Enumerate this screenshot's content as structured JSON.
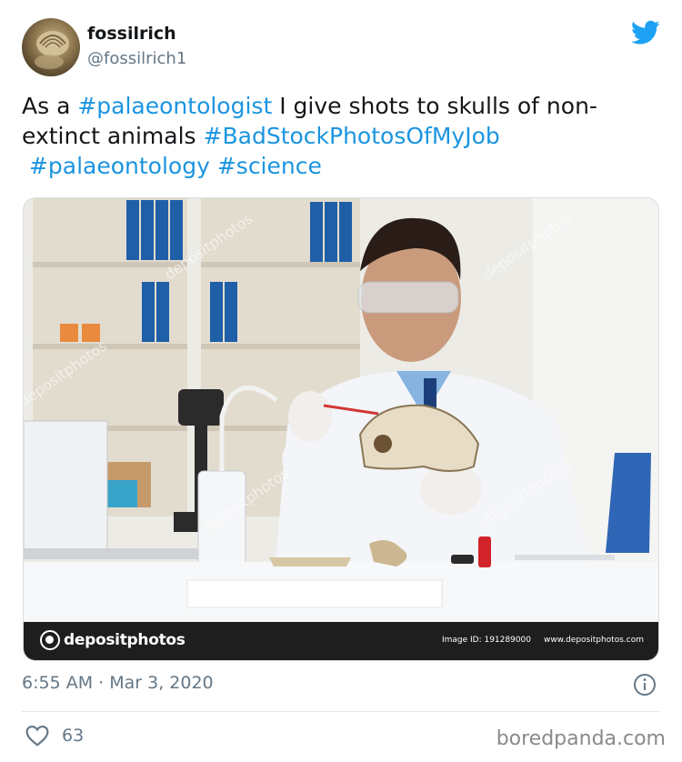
{
  "tweet": {
    "display_name": "fossilrich",
    "handle": "@fossilrich1",
    "text": {
      "part1": "As a ",
      "tag1": "#palaeontologist",
      "part2": " I give shots to skulls of non-extinct animals ",
      "tag2": "#BadStockPhotosOfMyJob",
      "tag3": "#palaeontology",
      "tag4": "#science"
    },
    "timestamp": "6:55 AM · Mar 3, 2020",
    "likes": "63"
  },
  "photo": {
    "brand": "depositphotos",
    "image_id": "Image ID: 191289000",
    "url": "www.depositphotos.com"
  },
  "source_watermark": "boredpanda.com",
  "icons": {
    "avatar": "fossil-avatar",
    "brand_logo": "twitter-bird-icon",
    "info": "info-icon",
    "like": "heart-icon"
  },
  "colors": {
    "hashtag": "#1b95e0",
    "twitter_blue": "#1da1f2",
    "muted": "#657786"
  }
}
